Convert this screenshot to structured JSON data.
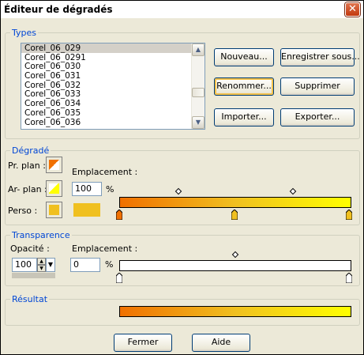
{
  "window": {
    "title": "Éditeur de dégradés",
    "close_symbol": "✕"
  },
  "types": {
    "legend": "Types",
    "items": [
      "Corel_06_029",
      "Corel_06_0291",
      "Corel_06_030",
      "Corel_06_031",
      "Corel_06_032",
      "Corel_06_033",
      "Corel_06_034",
      "Corel_06_035",
      "Corel_06_036"
    ],
    "selected_index": 0,
    "buttons": {
      "new": "Nouveau...",
      "save": "Enregistrer sous...",
      "rename": "Renommer...",
      "delete": "Supprimer",
      "import": "Importer...",
      "export": "Exporter..."
    }
  },
  "gradient": {
    "legend": "Dégradé",
    "foreground_label": "Pr. plan :",
    "background_label": "Ar- plan :",
    "custom_label": "Perso :",
    "location_label": "Emplacement :",
    "location_value": "100",
    "percent": "%",
    "start_color": "#f07000",
    "end_color": "#ffff00",
    "custom_color": "#f0c020"
  },
  "transparency": {
    "legend": "Transparence",
    "opacity_label": "Opacité :",
    "opacity_value": "100",
    "location_label": "Emplacement :",
    "location_value": "0",
    "percent": "%"
  },
  "result": {
    "legend": "Résultat"
  },
  "footer": {
    "close": "Fermer",
    "help": "Aide"
  }
}
